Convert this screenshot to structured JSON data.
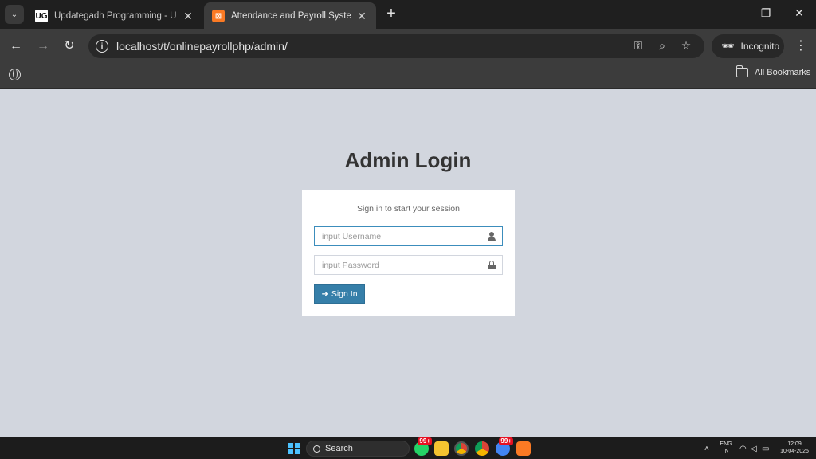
{
  "tabs": [
    {
      "title": "Updategadh Programming - Upda",
      "favicon": "ug-icon",
      "close": "✕"
    },
    {
      "title": "Attendance and Payroll System",
      "favicon": "xampp-icon",
      "close": "✕"
    }
  ],
  "new_tab": "+",
  "window_controls": {
    "minimize": "—",
    "restore": "❐",
    "close": "✕"
  },
  "address_bar": {
    "url": "localhost/t/onlinepayrollphp/admin/"
  },
  "incognito_label": "Incognito",
  "bookmarks": {
    "all_bookmarks": "All Bookmarks"
  },
  "login": {
    "title": "Admin Login",
    "message": "Sign in to start your session",
    "username_placeholder": "input Username",
    "password_placeholder": "input Password",
    "signin_label": "Sign In"
  },
  "taskbar": {
    "search_label": "Search",
    "badge_1": "99+",
    "badge_2": "99+",
    "lang_line1": "ENG",
    "lang_line2": "IN",
    "time": "12:09",
    "date": "10-04-2025"
  },
  "colors": {
    "page_background": "#d2d6de",
    "primary_button": "#367fa9",
    "focus_border": "#3c8dbc",
    "chrome_dark": "#1f1f1f",
    "chrome_toolbar": "#3c3c3c"
  }
}
